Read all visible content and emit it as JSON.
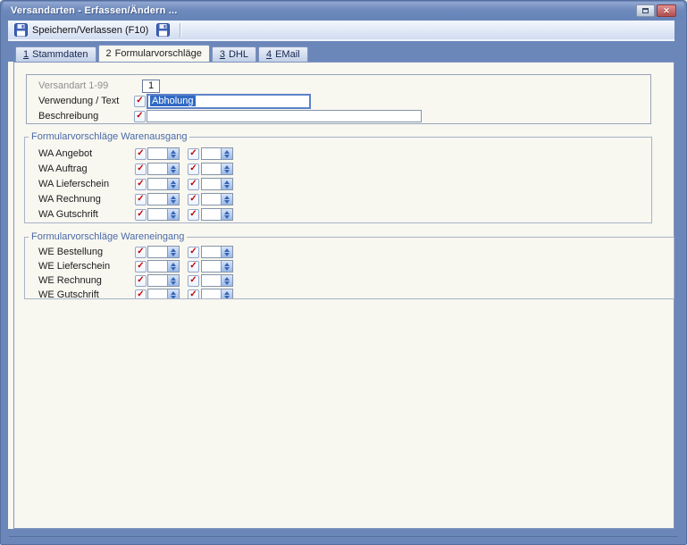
{
  "window": {
    "title": "Versandarten - Erfassen/Ändern ..."
  },
  "toolbar": {
    "save_exit_label": "Speichern/Verlassen (F10)"
  },
  "tabs": [
    {
      "number": "1",
      "label": "Stammdaten"
    },
    {
      "number": "2",
      "label": "Formularvorschläge"
    },
    {
      "number": "3",
      "label": "DHL"
    },
    {
      "number": "4",
      "label": "EMail"
    }
  ],
  "form": {
    "versandart_label": "Versandart 1-99",
    "versandart_value": "1",
    "verwendung_label": "Verwendung / Text",
    "verwendung_value": "Abholung",
    "beschreibung_label": "Beschreibung",
    "beschreibung_value": ""
  },
  "groups": [
    {
      "title": "Formularvorschläge Warenausgang",
      "rows": [
        {
          "label": "WA Angebot",
          "left_value": "",
          "right_value": ""
        },
        {
          "label": "WA Auftrag",
          "left_value": "",
          "right_value": ""
        },
        {
          "label": "WA Lieferschein",
          "left_value": "",
          "right_value": ""
        },
        {
          "label": "WA Rechnung",
          "left_value": "",
          "right_value": ""
        },
        {
          "label": "WA Gutschrift",
          "left_value": "",
          "right_value": ""
        }
      ]
    },
    {
      "title": "Formularvorschläge Wareneingang",
      "rows": [
        {
          "label": "WE Bestellung",
          "left_value": "",
          "right_value": ""
        },
        {
          "label": "WE Lieferschein",
          "left_value": "",
          "right_value": ""
        },
        {
          "label": "WE Rechnung",
          "left_value": "",
          "right_value": ""
        },
        {
          "label": "WE Gutschrift",
          "left_value": "",
          "right_value": ""
        }
      ]
    }
  ],
  "colors": {
    "frame_blue": "#6b87ba",
    "panel_background": "#f8f7f0",
    "selection_blue": "#316ac5",
    "check_red": "#c00000",
    "group_title_blue": "#4a6aa8",
    "close_button_red": "#b24f4f"
  }
}
